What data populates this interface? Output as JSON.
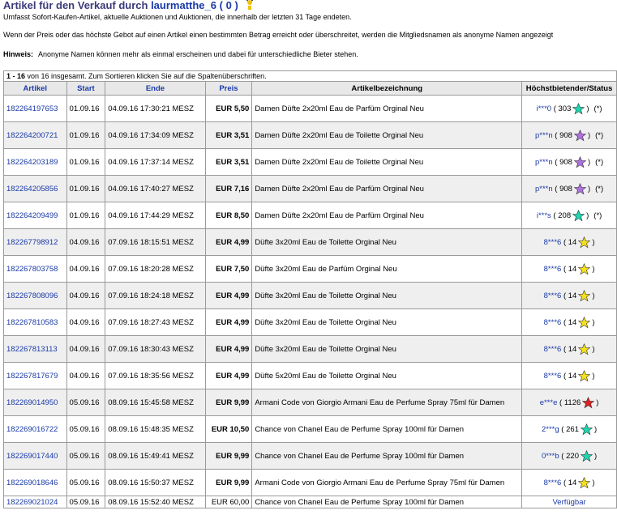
{
  "header": {
    "title_prefix": "Artikel für den Verkauf durch",
    "seller": "laurmatthe_6",
    "feedback_open": "(",
    "feedback": "0",
    "feedback_close": ")",
    "icon": "new-member-icon"
  },
  "info": {
    "line1": "Umfasst Sofort-Kaufen-Artikel, aktuelle Auktionen und Auktionen, die innerhalb der letzten 31 Tage endeten.",
    "line2": "Wenn der Preis oder das höchste Gebot auf einen Artikel einen bestimmten Betrag erreicht oder überschreitet, werden die Mitgliedsnamen als anonyme Namen angezeigt",
    "hint_label": "Hinweis:",
    "hint_text": "Anonyme Namen können mehr als einmal erscheinen und dabei für unterschiedliche Bieter stehen."
  },
  "table": {
    "caption_range": "1 - 16",
    "caption_rest": " von 16 insgesamt. Zum Sortieren klicken Sie auf die Spaltenüberschriften.",
    "headers": {
      "artikel": "Artikel",
      "start": "Start",
      "ende": "Ende",
      "preis": "Preis",
      "bezeichnung": "Artikelbezeichnung",
      "status": "Höchstbietender/Status"
    },
    "rows": [
      {
        "id": "182264197653",
        "start": "01.09.16",
        "end": "04.09.16 17:30:21 MESZ",
        "price": "EUR 5,50",
        "title": "Damen Düfte 2x20ml Eau de Parfüm Orginal Neu",
        "bidder": "i***0",
        "score": "303",
        "star": "#1fd6b0",
        "ast": "(*)"
      },
      {
        "id": "182264200721",
        "start": "01.09.16",
        "end": "04.09.16 17:34:09 MESZ",
        "price": "EUR 3,51",
        "title": "Damen Düfte 2x20ml Eau de Toilette Orginal Neu",
        "bidder": "p***n",
        "score": "908",
        "star": "#b070e0",
        "ast": "(*)"
      },
      {
        "id": "182264203189",
        "start": "01.09.16",
        "end": "04.09.16 17:37:14 MESZ",
        "price": "EUR 3,51",
        "title": "Damen Düfte 2x20ml Eau de Toilette Orginal Neu",
        "bidder": "p***n",
        "score": "908",
        "star": "#b070e0",
        "ast": "(*)"
      },
      {
        "id": "182264205856",
        "start": "01.09.16",
        "end": "04.09.16 17:40:27 MESZ",
        "price": "EUR 7,16",
        "title": "Damen Düfte 2x20ml Eau de Parfüm Orginal Neu",
        "bidder": "p***n",
        "score": "908",
        "star": "#b070e0",
        "ast": "(*)"
      },
      {
        "id": "182264209499",
        "start": "01.09.16",
        "end": "04.09.16 17:44:29 MESZ",
        "price": "EUR 8,50",
        "title": "Damen Düfte 2x20ml Eau de Parfüm Orginal Neu",
        "bidder": "i***s",
        "score": "208",
        "star": "#1fd6b0",
        "ast": "(*)"
      },
      {
        "id": "182267798912",
        "start": "04.09.16",
        "end": "07.09.16 18:15:51 MESZ",
        "price": "EUR 4,99",
        "title": "Düfte 3x20ml Eau de Toilette Orginal Neu",
        "bidder": "8***6",
        "score": "14",
        "star": "#f6e01a",
        "ast": ""
      },
      {
        "id": "182267803758",
        "start": "04.09.16",
        "end": "07.09.16 18:20:28 MESZ",
        "price": "EUR 7,50",
        "title": "Düfte 3x20ml Eau de Parfüm Orginal Neu",
        "bidder": "8***6",
        "score": "14",
        "star": "#f6e01a",
        "ast": ""
      },
      {
        "id": "182267808096",
        "start": "04.09.16",
        "end": "07.09.16 18:24:18 MESZ",
        "price": "EUR 4,99",
        "title": "Düfte 3x20ml Eau de Toilette Orginal Neu",
        "bidder": "8***6",
        "score": "14",
        "star": "#f6e01a",
        "ast": ""
      },
      {
        "id": "182267810583",
        "start": "04.09.16",
        "end": "07.09.16 18:27:43 MESZ",
        "price": "EUR 4,99",
        "title": "Düfte 3x20ml Eau de Toilette Orginal Neu",
        "bidder": "8***6",
        "score": "14",
        "star": "#f6e01a",
        "ast": ""
      },
      {
        "id": "182267813113",
        "start": "04.09.16",
        "end": "07.09.16 18:30:43 MESZ",
        "price": "EUR 4,99",
        "title": "Düfte 3x20ml Eau de Toilette Orginal Neu",
        "bidder": "8***6",
        "score": "14",
        "star": "#f6e01a",
        "ast": ""
      },
      {
        "id": "182267817679",
        "start": "04.09.16",
        "end": "07.09.16 18:35:56 MESZ",
        "price": "EUR 4,99",
        "title": "Düfte 5x20ml Eau de Toilette Orginal Neu",
        "bidder": "8***6",
        "score": "14",
        "star": "#f6e01a",
        "ast": ""
      },
      {
        "id": "182269014950",
        "start": "05.09.16",
        "end": "08.09.16 15:45:58 MESZ",
        "price": "EUR 9,99",
        "title": "Armani Code von Giorgio Armani Eau de Perfume Spray 75ml für Damen",
        "bidder": "e***e",
        "score": "1126",
        "star": "#e02020",
        "ast": ""
      },
      {
        "id": "182269016722",
        "start": "05.09.16",
        "end": "08.09.16 15:48:35 MESZ",
        "price": "EUR 10,50",
        "title": "Chance von Chanel Eau de Perfume Spray 100ml für Damen",
        "bidder": "2***g",
        "score": "261",
        "star": "#1fd6b0",
        "ast": ""
      },
      {
        "id": "182269017440",
        "start": "05.09.16",
        "end": "08.09.16 15:49:41 MESZ",
        "price": "EUR 9,99",
        "title": "Chance von Chanel Eau de Perfume Spray 100ml für Damen",
        "bidder": "0***b",
        "score": "220",
        "star": "#1fd6b0",
        "ast": ""
      },
      {
        "id": "182269018646",
        "start": "05.09.16",
        "end": "08.09.16 15:50:37 MESZ",
        "price": "EUR 9,99",
        "title": "Armani Code von Giorgio Armani Eau de Perfume Spray 75ml für Damen",
        "bidder": "8***6",
        "score": "14",
        "star": "#f6e01a",
        "ast": ""
      }
    ],
    "last_row": {
      "id": "182269021024",
      "start": "05.09.16",
      "end": "08.09.16 15:52:40 MESZ",
      "price": "EUR 60,00",
      "title": "Chance von Chanel Eau de Perfume Spray 100ml für Damen",
      "status": "Verfügbar"
    }
  }
}
